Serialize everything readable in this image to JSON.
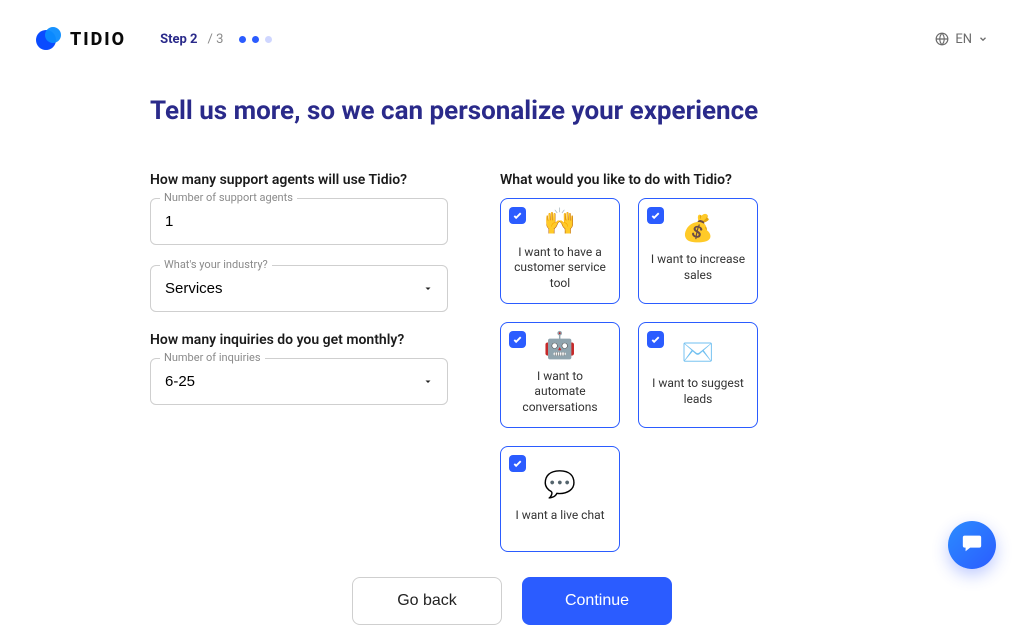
{
  "brand": "TIDIO",
  "header": {
    "step_label": "Step 2",
    "step_total": "/ 3",
    "language": "EN"
  },
  "headline": "Tell us more, so we can personalize your experience",
  "left": {
    "q_agents": "How many support agents will use Tidio?",
    "agents_float": "Number of support agents",
    "agents_value": "1",
    "industry_float": "What's your industry?",
    "industry_value": "Services",
    "q_inquiries": "How many inquiries do you get monthly?",
    "inquiries_float": "Number of inquiries",
    "inquiries_value": "6-25"
  },
  "right": {
    "question": "What would you like to do with Tidio?",
    "tiles": [
      {
        "icon": "🙌",
        "label": "I want to have a customer service tool"
      },
      {
        "icon": "💰",
        "label": "I want to increase sales"
      },
      {
        "icon": "🤖",
        "label": "I want to automate conversations"
      },
      {
        "icon": "✉️",
        "label": "I want to suggest leads"
      },
      {
        "icon": "💬",
        "label": "I want a live chat"
      }
    ]
  },
  "footer": {
    "back": "Go back",
    "continue": "Continue"
  }
}
